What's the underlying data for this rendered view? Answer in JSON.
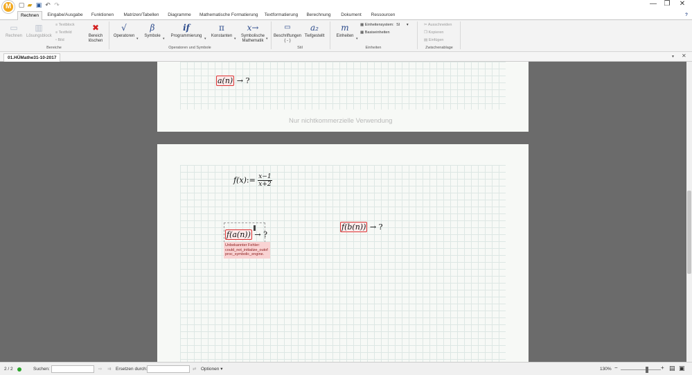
{
  "window": {
    "minimize_glyph": "—",
    "restore_glyph": "❐",
    "close_glyph": "✕",
    "help_glyph": "?"
  },
  "app_logo_letter": "M",
  "tabs": [
    "Rechnen",
    "Eingabe/Ausgabe",
    "Funktionen",
    "Matrizen/Tabellen",
    "Diagramme",
    "Mathematische Formatierung",
    "Textformatierung",
    "Berechnung",
    "Dokument",
    "Ressourcen"
  ],
  "ribbon": {
    "bereiche": {
      "label": "Bereiche",
      "rechnen": "Rechnen",
      "loesungsblock": "Lösungsblock",
      "textblock": "Textblock",
      "textfeld": "Textfeld",
      "bild": "Bild",
      "bereich_loeschen_1": "Bereich",
      "bereich_loeschen_2": "löschen"
    },
    "operatoren": {
      "label": "Operatoren und Symbole",
      "operatoren": "Operatoren",
      "symbole": "Symbole",
      "programmierung": "Programmierung",
      "konstanten": "Konstanten",
      "symbolische_1": "Symbolische",
      "symbolische_2": "Mathematik",
      "icon_symbole": "β",
      "icon_programmierung": "if",
      "icon_konstanten": "π",
      "icon_symbolisch": "x→"
    },
    "stil": {
      "label": "Stil",
      "beschriftungen": "Beschriftungen",
      "beschriftungen_sub": "( - )",
      "tiefgestellt": "Tiefgestellt",
      "icon_tief": "a₂"
    },
    "einheiten": {
      "label": "Einheiten",
      "einheiten": "Einheiten",
      "icon": "m",
      "einheitensystem": "Einheitensystem:",
      "system_value": "SI",
      "basiseinheiten": "Basiseinheiten"
    },
    "zwischenablage": {
      "label": "Zwischenablage",
      "ausschneiden": "Ausschneiden",
      "kopieren": "Kopieren",
      "einfuegen": "Einfügen"
    }
  },
  "document_tab": "01.HÜMathe31-10-2017",
  "page1": {
    "expr_lhs": "a(n)",
    "arrow": "→ ?",
    "watermark": "Nur nichtkommerzielle Verwendung"
  },
  "page2": {
    "def_lhs": "f(x)",
    "def_op": ":=",
    "num": "x−1",
    "den": "x+2",
    "expr1_lhs": "f(a(n))",
    "expr1_arrow": "→ ?",
    "expr2_lhs": "f(b(n))",
    "expr2_arrow": "→ ?",
    "error_lines": [
      "Unbekannter Fehler:",
      "could_not_initialize_outof",
      "proc_symbolic_engine."
    ]
  },
  "status": {
    "pages": "2 / 2",
    "suchen": "Suchen:",
    "ersetzen": "Ersetzen durch:",
    "optionen": "Optionen",
    "zoom": "130%",
    "zoom_minus": "−",
    "zoom_plus": "+",
    "zoom_level": 0.65
  },
  "colors": {
    "status_dot": "#2aa52a",
    "error_highlight": "#d33333"
  }
}
